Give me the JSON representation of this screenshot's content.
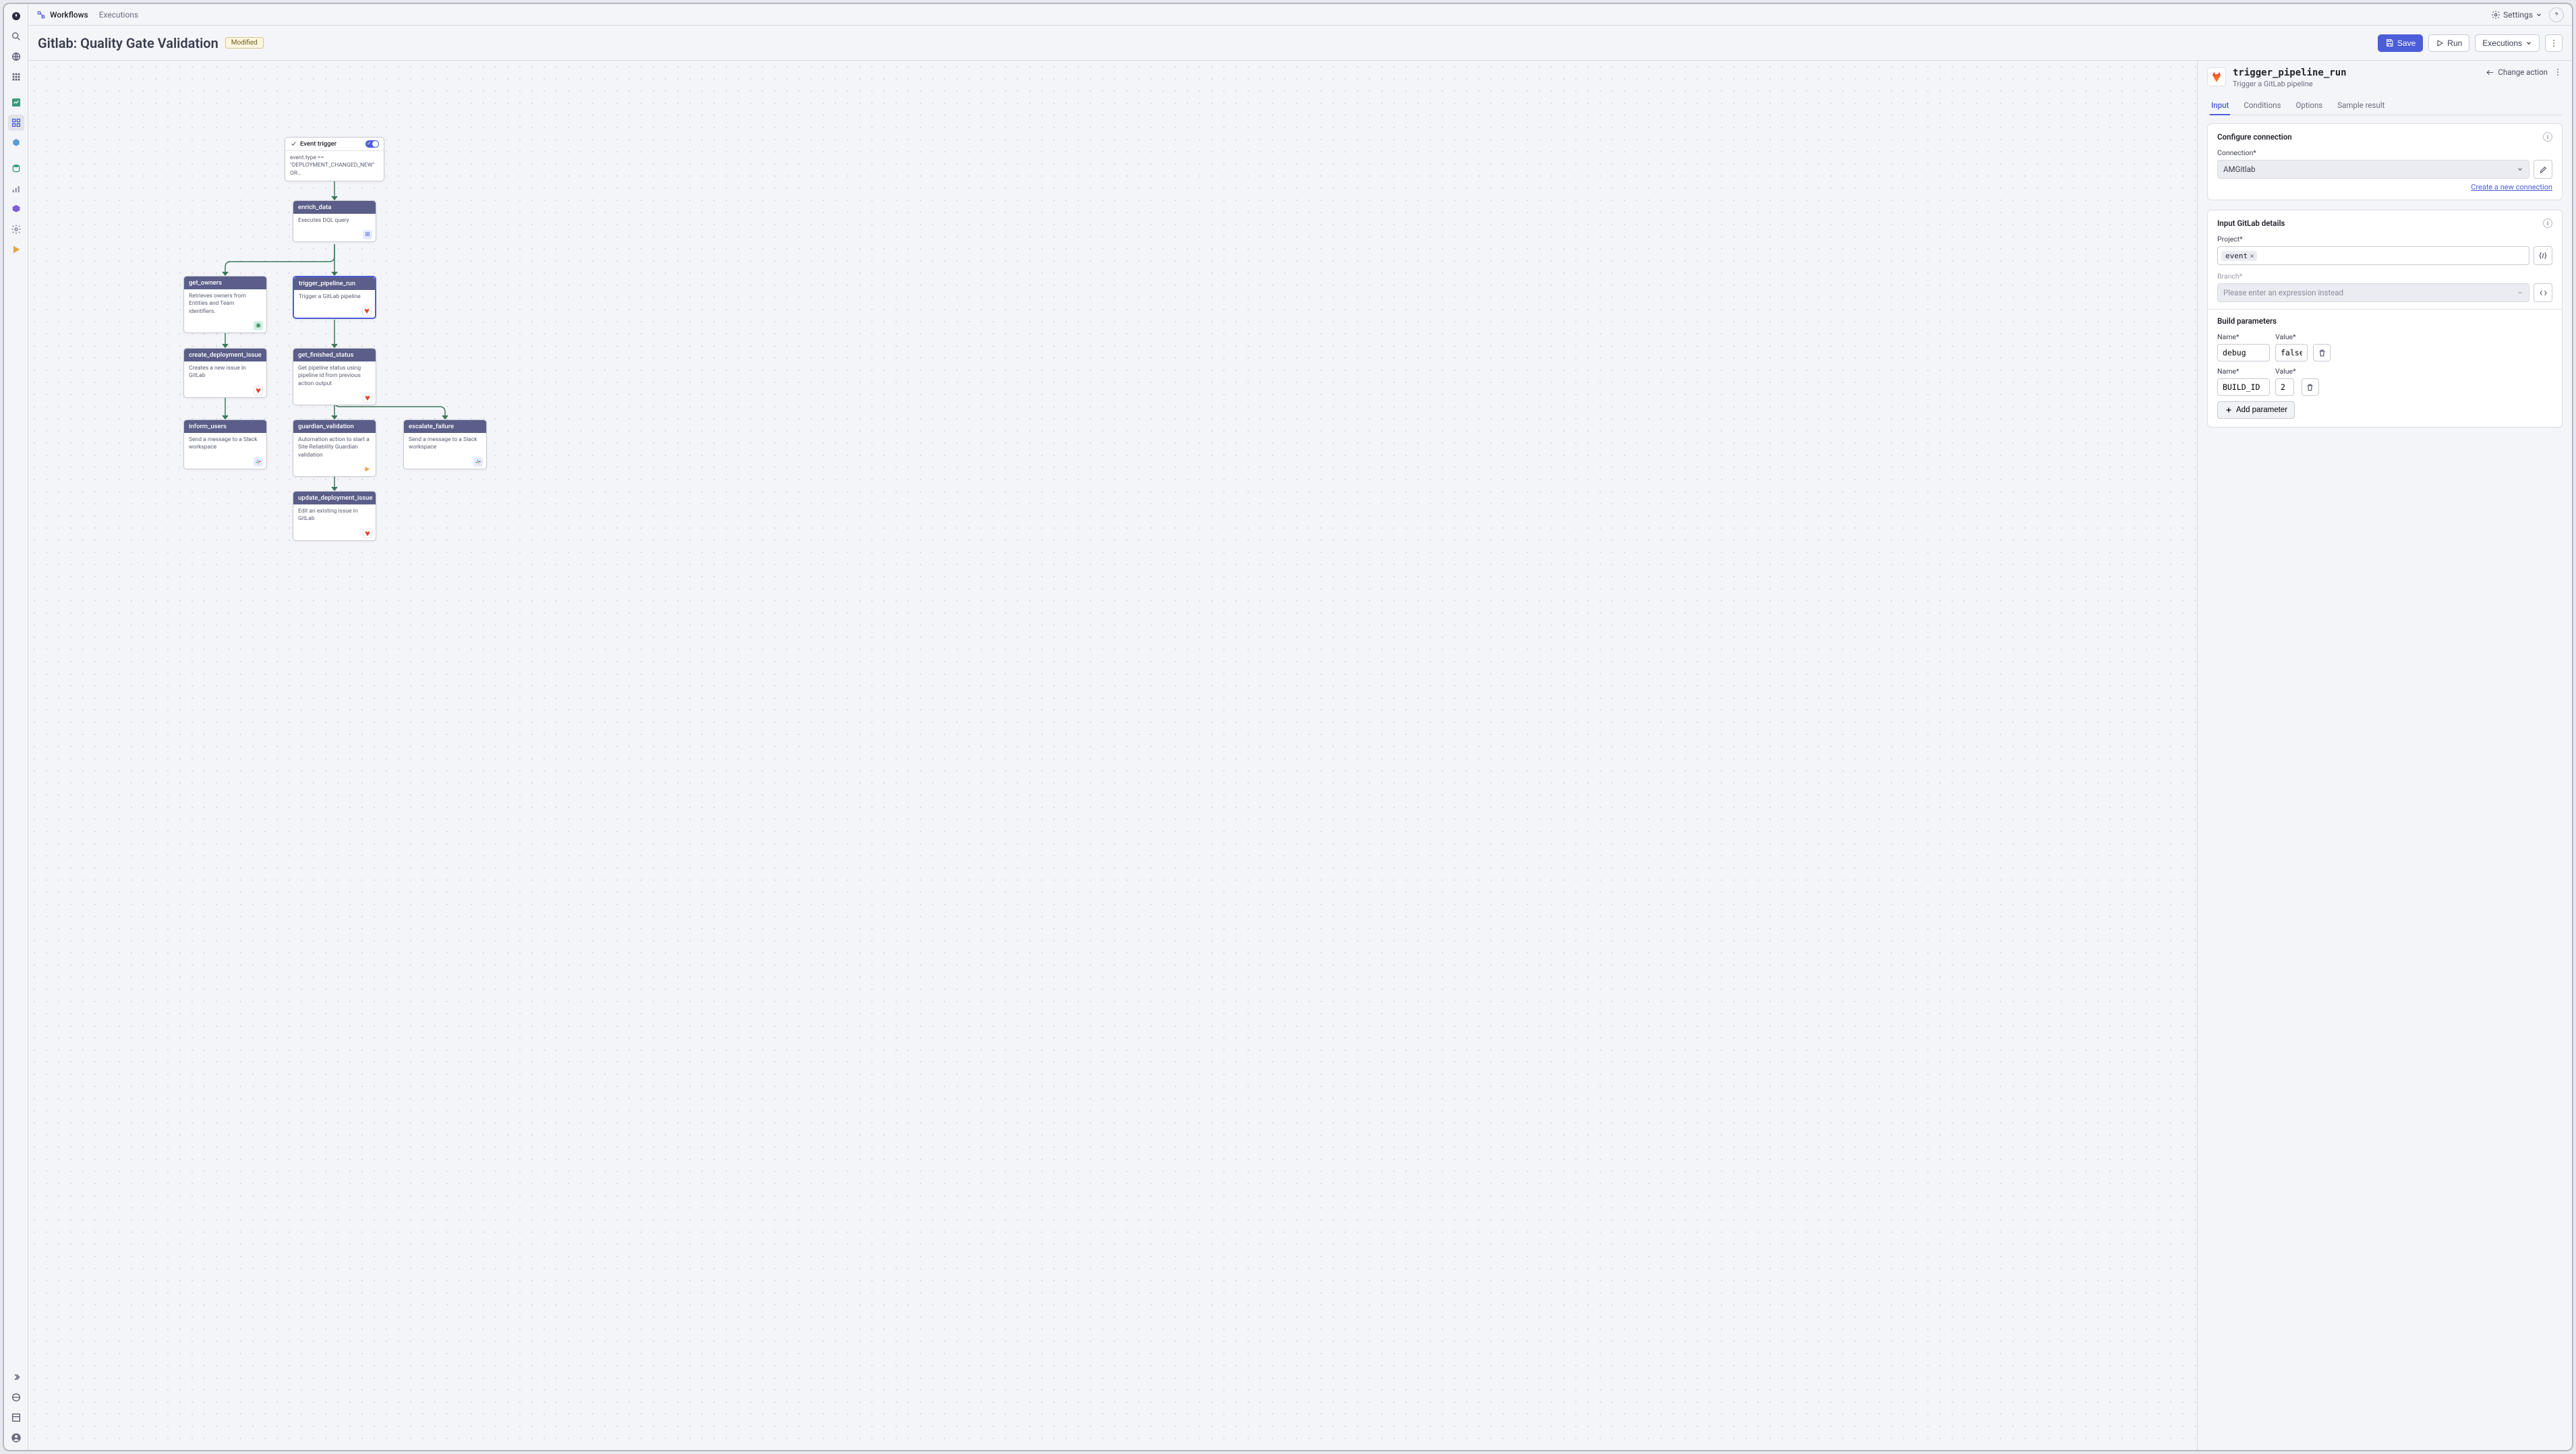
{
  "sidebar": {
    "top_icons": [
      "compass-icon",
      "search-icon",
      "globe-icon",
      "apps-icon"
    ],
    "mid_icons": [
      "chart-icon",
      "grid-icon",
      "hex-icon"
    ],
    "low_icons": [
      "database-icon",
      "bars-icon",
      "cube-icon",
      "gear-icon",
      "play-icon"
    ],
    "bottom_icons": [
      "expand-icon",
      "world-icon",
      "dashboard-icon",
      "avatar-icon"
    ]
  },
  "topbar": {
    "tab_workflows": "Workflows",
    "tab_executions": "Executions",
    "settings": "Settings"
  },
  "titlebar": {
    "title": "Gitlab: Quality Gate Validation",
    "badge": "Modified",
    "save": "Save",
    "run": "Run",
    "executions": "Executions"
  },
  "nodes": {
    "trigger": {
      "title": "Event trigger",
      "body": "event.type == \"DEPLOYMENT_CHANGED_NEW\" OR…"
    },
    "enrich": {
      "title": "enrich_data",
      "body": "Executes DQL query"
    },
    "owners": {
      "title": "get_owners",
      "body": "Retrieves owners from Entities and Team identifiers."
    },
    "pipeline": {
      "title": "trigger_pipeline_run",
      "body": "Trigger a GitLab pipeline"
    },
    "create_issue": {
      "title": "create_deployment_issue",
      "body": "Creates a new issue in GitLab"
    },
    "status": {
      "title": "get_finished_status",
      "body": "Get pipeline status using pipeline id from previous action output"
    },
    "inform": {
      "title": "inform_users",
      "body": "Send a message to a Slack workspace"
    },
    "guardian": {
      "title": "guardian_validation",
      "body": "Automation action to start a Site Reliability Guardian validation"
    },
    "escalate": {
      "title": "escalate_failure",
      "body": "Send a message to a Slack workspace"
    },
    "update": {
      "title": "update_deployment_issue",
      "body": "Edit an existing issue in GitLab"
    }
  },
  "details": {
    "title": "trigger_pipeline_run",
    "subtitle": "Trigger a GitLab pipeline",
    "change_action": "Change action",
    "tabs": {
      "input": "Input",
      "conditions": "Conditions",
      "options": "Options",
      "sample": "Sample result"
    },
    "connection": {
      "section": "Configure connection",
      "label": "Connection*",
      "value": "AMGitlab",
      "new_link": "Create a new connection"
    },
    "gitlab": {
      "section": "Input GitLab details",
      "project_label": "Project*",
      "project_chip": "event",
      "branch_label": "Branch*",
      "branch_placeholder": "Please enter an expression instead"
    },
    "params": {
      "section": "Build parameters",
      "name_label": "Name*",
      "value_label": "Value*",
      "rows": [
        {
          "name": "debug",
          "value": "false"
        },
        {
          "name": "BUILD_ID",
          "value": "2"
        }
      ],
      "add": "Add parameter"
    }
  }
}
